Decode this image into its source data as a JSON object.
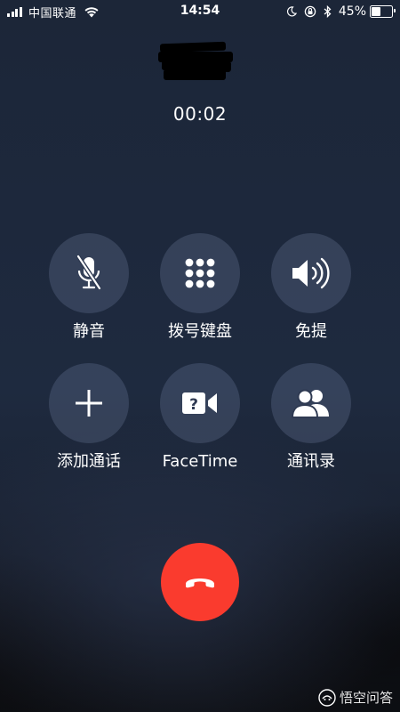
{
  "status_bar": {
    "carrier": "中国联通",
    "time": "14:54",
    "battery_percent": "45%",
    "battery_level": 0.45,
    "signal_bars": 4,
    "icons": [
      "signal-icon",
      "wifi-icon",
      "moon-icon",
      "orientation-lock-icon",
      "bluetooth-icon",
      "battery-icon"
    ]
  },
  "call": {
    "caller_name": "",
    "caller_name_redacted": true,
    "duration": "00:02"
  },
  "controls": [
    {
      "label": "静音",
      "icon": "mute-icon"
    },
    {
      "label": "拨号键盘",
      "icon": "keypad-icon"
    },
    {
      "label": "免提",
      "icon": "speaker-icon"
    },
    {
      "label": "添加通话",
      "icon": "add-call-icon"
    },
    {
      "label": "FaceTime",
      "icon": "facetime-icon"
    },
    {
      "label": "通讯录",
      "icon": "contacts-icon"
    }
  ],
  "end_call": {
    "icon": "end-call-icon",
    "color": "#fa3b2e"
  },
  "watermark": {
    "text": "悟空问答"
  }
}
